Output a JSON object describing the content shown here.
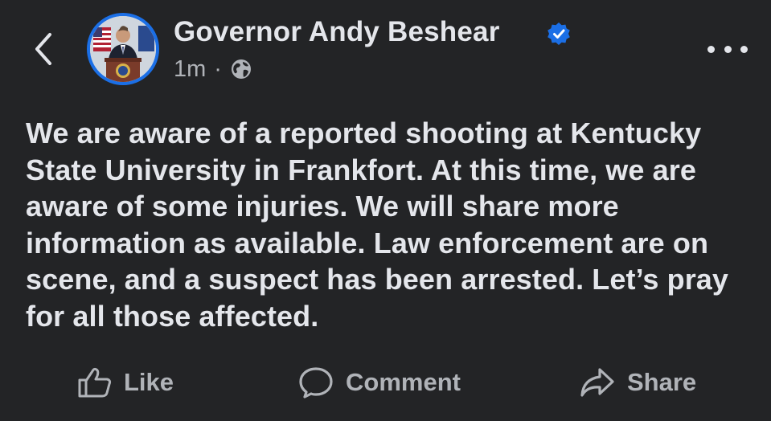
{
  "header": {
    "back_icon": "chevron-left-icon",
    "author_name": "Governor Andy Beshear",
    "verified_icon": "verified-badge-icon",
    "timestamp": "1m",
    "separator": "·",
    "audience_icon": "globe-icon",
    "more_icon": "more-horizontal-icon"
  },
  "post": {
    "text": "We are aware of a reported shooting at Kentucky State University in Frankfort. At this time, we are aware of some injuries. We will share more information as available. Law enforcement are on scene, and a suspect has been arrested. Let’s pray for all those affected."
  },
  "actions": {
    "like_label": "Like",
    "comment_label": "Comment",
    "share_label": "Share"
  },
  "colors": {
    "background": "#232426",
    "text_primary": "#e4e6eb",
    "text_secondary": "#b0b3b8",
    "accent_blue": "#1b6fe6"
  }
}
